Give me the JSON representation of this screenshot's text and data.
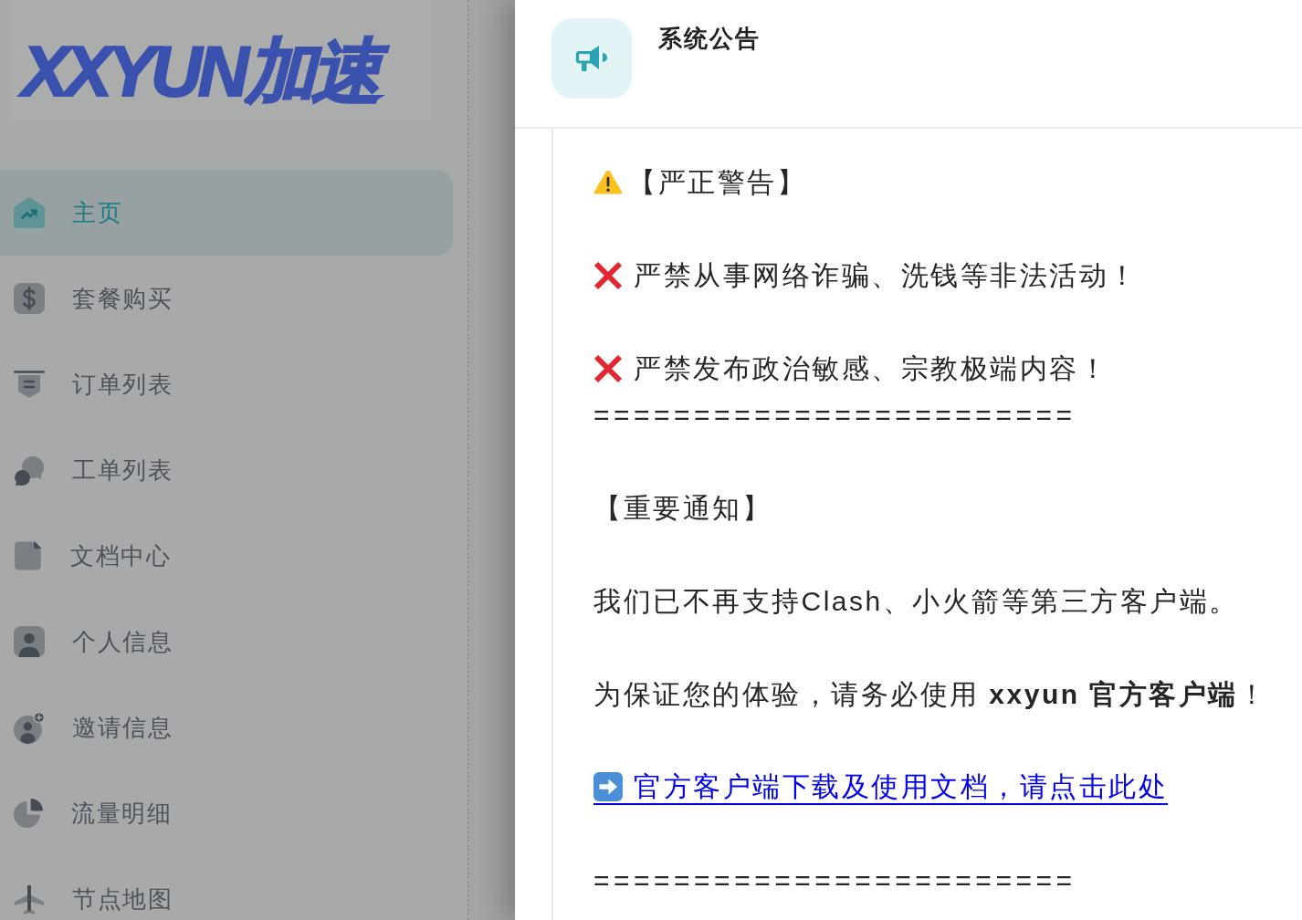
{
  "sidebar": {
    "logo": "XXYUN加速",
    "items": [
      {
        "label": "主页",
        "selected": true
      },
      {
        "label": "套餐购买",
        "selected": false
      },
      {
        "label": "订单列表",
        "selected": false
      },
      {
        "label": "工单列表",
        "selected": false
      },
      {
        "label": "文档中心",
        "selected": false
      },
      {
        "label": "个人信息",
        "selected": false
      },
      {
        "label": "邀请信息",
        "selected": false
      },
      {
        "label": "流量明细",
        "selected": false
      },
      {
        "label": "节点地图",
        "selected": false
      }
    ]
  },
  "dialog": {
    "title": "系统公告",
    "paragraphs": [
      {
        "lines": [
          {
            "kind": "warning",
            "text": "【严正警告】"
          }
        ]
      },
      {
        "lines": [
          {
            "kind": "prohibited",
            "text": "严禁从事网络诈骗、洗钱等非法活动！"
          }
        ]
      },
      {
        "lines": [
          {
            "kind": "prohibited",
            "text": "严禁发布政治敏感、宗教极端内容！"
          },
          {
            "kind": "rule",
            "text": "========================"
          }
        ]
      },
      {
        "lines": [
          {
            "kind": "plain",
            "text": "【重要通知】"
          }
        ]
      },
      {
        "lines": [
          {
            "kind": "plain",
            "text": "我们已不再支持Clash、小火箭等第三方客户端。"
          }
        ]
      },
      {
        "lines": [
          {
            "kind": "plain",
            "text": "为保证您的体验，请务必使用 **xxyun 官方客户端**！"
          }
        ]
      },
      {
        "lines": [
          {
            "kind": "link",
            "text": "官方客户端下载及使用文档，请点击此处"
          }
        ]
      },
      {
        "lines": [
          {
            "kind": "rule",
            "text": "========================"
          }
        ]
      }
    ]
  }
}
